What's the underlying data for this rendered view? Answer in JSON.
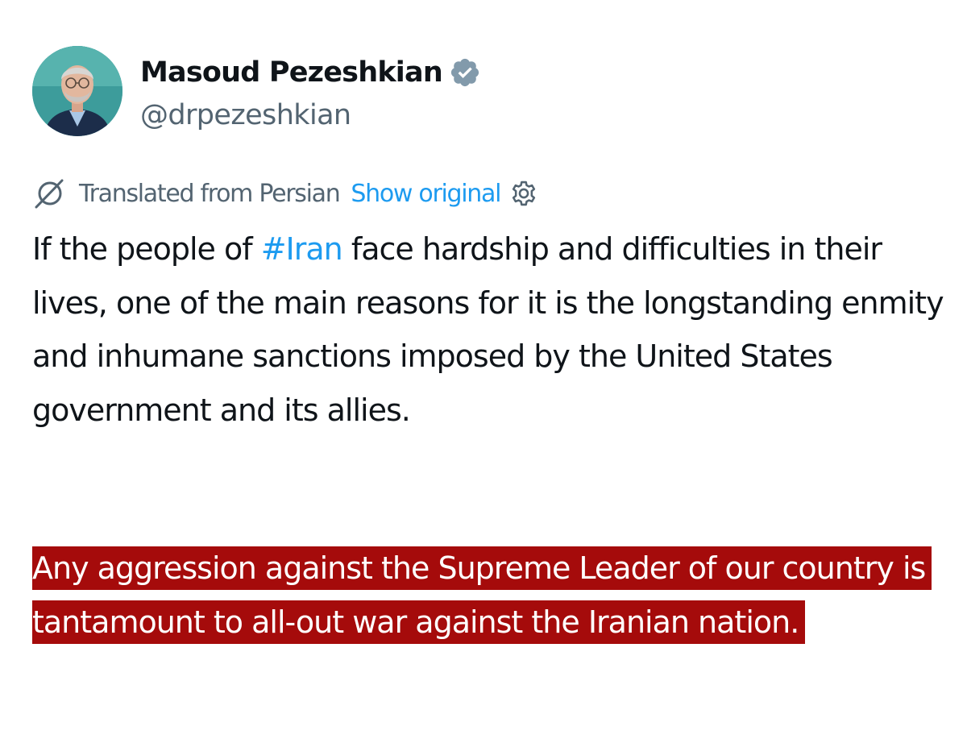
{
  "tweet": {
    "author": {
      "display_name": "Masoud Pezeshkian",
      "handle": "@drpezeshkian",
      "verified": true
    },
    "translation": {
      "label": "Translated from Persian",
      "show_original_label": "Show original"
    },
    "body": {
      "para1_before": "If the people of ",
      "hashtag": "#Iran",
      "para1_after": " face hardship and difficulties in their lives, one of the main reasons for it is the longstanding enmity and inhumane sanctions imposed by the United States government and its allies.",
      "para2_highlighted": "Any aggression against the Supreme Leader of our country is tantamount to all-out war against the Iranian nation."
    }
  },
  "colors": {
    "text": "#0f1419",
    "secondary": "#536471",
    "link": "#1d9bf0",
    "highlight_bg": "#a50b0b",
    "highlight_text": "#ffffff",
    "verified_badge": "#829aab"
  },
  "icons": {
    "verified": "verified-badge-icon",
    "translate": "translate-icon",
    "settings": "gear-icon"
  }
}
